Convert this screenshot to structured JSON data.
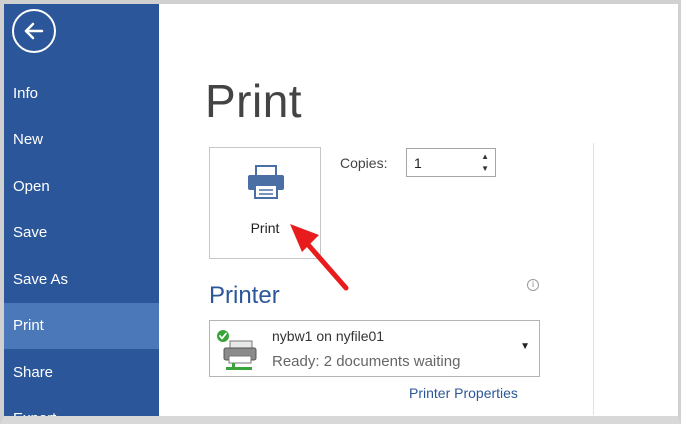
{
  "sidebar": {
    "back_icon": "back-arrow-icon",
    "items": [
      {
        "label": "Info"
      },
      {
        "label": "New"
      },
      {
        "label": "Open"
      },
      {
        "label": "Save"
      },
      {
        "label": "Save As"
      },
      {
        "label": "Print",
        "active": true
      },
      {
        "label": "Share"
      },
      {
        "label": "Export"
      }
    ],
    "color": "#2b579a",
    "active_color": "#4a78b8"
  },
  "main": {
    "title": "Print",
    "print_button": {
      "label": "Print",
      "icon": "printer-icon"
    },
    "copies": {
      "label": "Copies:",
      "value": "1"
    },
    "printer_section": {
      "heading": "Printer",
      "info_icon": "info-icon",
      "selected_printer": {
        "name": "nybw1 on nyfile01",
        "status": "Ready: 2 documents waiting",
        "icon": "network-printer-icon"
      },
      "properties_link": "Printer Properties"
    }
  },
  "annotation": {
    "type": "red-arrow",
    "color": "#e81c1c",
    "points_to": "print-button"
  }
}
